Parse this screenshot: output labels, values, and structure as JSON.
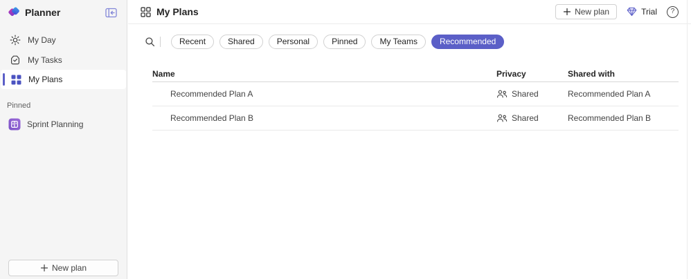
{
  "app_title": "Planner",
  "colors": {
    "accent": "#5b5fc7",
    "sidebar_bg": "#f5f5f5",
    "grid_icon_blue": "#4b53c1",
    "text_primary": "#242424",
    "text_secondary": "#424242",
    "text_muted": "#616161",
    "chip_border": "#d1d1d1"
  },
  "sidebar": {
    "items": [
      {
        "label": "My Day",
        "icon": "sun-icon",
        "selected": false
      },
      {
        "label": "My Tasks",
        "icon": "task-check-icon",
        "selected": false
      },
      {
        "label": "My Plans",
        "icon": "grid-filled-icon",
        "selected": true
      }
    ],
    "pinned_label": "Pinned",
    "pinned_items": [
      {
        "label": "Sprint Planning",
        "icon": "plan-board-icon"
      }
    ],
    "new_plan_label": "New plan"
  },
  "header": {
    "title": "My Plans",
    "new_plan_label": "New plan",
    "trial_label": "Trial",
    "help_glyph": "?"
  },
  "filters": {
    "chips": [
      {
        "label": "Recent",
        "selected": false
      },
      {
        "label": "Shared",
        "selected": false
      },
      {
        "label": "Personal",
        "selected": false
      },
      {
        "label": "Pinned",
        "selected": false
      },
      {
        "label": "My Teams",
        "selected": false
      },
      {
        "label": "Recommended",
        "selected": true
      }
    ]
  },
  "table": {
    "columns": [
      "Name",
      "Privacy",
      "Shared with"
    ],
    "rows": [
      {
        "name": "Recommended Plan A",
        "privacy": "Shared",
        "shared_with": "Recommended Plan A"
      },
      {
        "name": "Recommended Plan B",
        "privacy": "Shared",
        "shared_with": "Recommended Plan B"
      }
    ]
  }
}
